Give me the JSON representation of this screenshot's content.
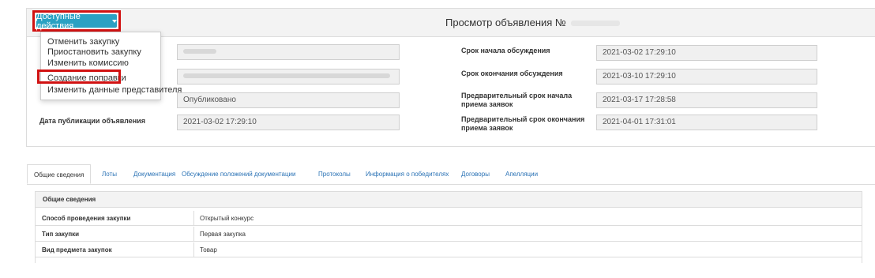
{
  "header": {
    "actions_label": "Доступные действия",
    "title": "Просмотр объявления №"
  },
  "actions_menu": {
    "items": [
      "Отменить закупку",
      "Приостановить закупку",
      "Изменить комиссию",
      "Создание поправки",
      "Изменить данные представителя"
    ],
    "highlighted": "Создание поправки"
  },
  "form": {
    "left": {
      "status_value": "Опубликовано",
      "publication_date_label": "Дата публикации объявления",
      "publication_date_value": "2021-03-02 17:29:10"
    },
    "right": [
      {
        "label": "Срок начала обсуждения",
        "value": "2021-03-02 17:29:10"
      },
      {
        "label": "Срок окончания обсуждения",
        "value": "2021-03-10 17:29:10"
      },
      {
        "label": "Предварительный срок начала приема заявок",
        "value": "2021-03-17 17:28:58"
      },
      {
        "label": "Предварительный срок окончания приема заявок",
        "value": "2021-04-01 17:31:01"
      }
    ]
  },
  "tabs": [
    "Общие сведения",
    "Лоты",
    "Документация",
    "Обсуждение положений документации",
    "Протоколы",
    "Информация о победителях",
    "Договоры",
    "Апелляции"
  ],
  "general_info": {
    "heading": "Общие сведения",
    "rows": [
      {
        "key": "Способ проведения закупки",
        "value": "Открытый конкурс"
      },
      {
        "key": "Тип закупки",
        "value": "Первая закупка"
      },
      {
        "key": "Вид предмета закупок",
        "value": "Товар"
      }
    ]
  },
  "colors": {
    "accent": "#2aa1c3",
    "highlight_border": "#d11212",
    "link": "#2a72b5"
  }
}
